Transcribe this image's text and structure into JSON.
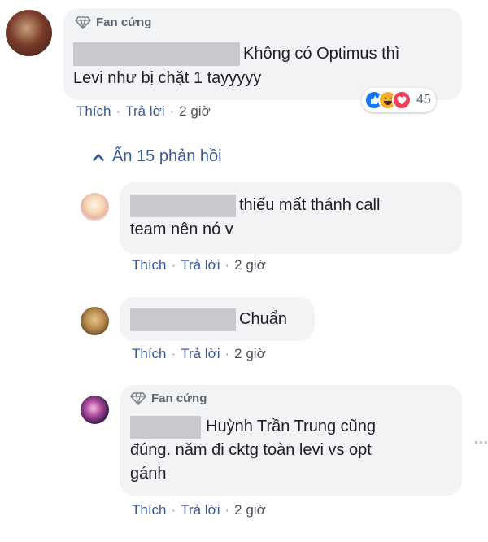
{
  "comment": {
    "badge": "Fan cứng",
    "text_line1": "Không có Optimus thì",
    "text_line2": "Levi như bị chặt 1 tayyyyy",
    "reactions": {
      "count": "45",
      "types": [
        "like-icon",
        "haha-icon",
        "love-icon"
      ]
    },
    "actions": {
      "like": "Thích",
      "reply": "Trả lời",
      "time": "2 giờ",
      "separator": "·"
    }
  },
  "replies_toggle": {
    "label": "Ẩn 15 phản hồi"
  },
  "replies": [
    {
      "text_line1": "thiếu mất thánh call",
      "text_line2": "team nên nó v",
      "actions": {
        "like": "Thích",
        "reply": "Trả lời",
        "time": "2 giờ",
        "separator": "·"
      }
    },
    {
      "text_line1": "Chuẩn",
      "actions": {
        "like": "Thích",
        "reply": "Trả lời",
        "time": "2 giờ",
        "separator": "·"
      }
    },
    {
      "badge": "Fan cứng",
      "text_line1": "Huỳnh Trần Trung cũng",
      "text_line2": "đúng. năm đi cktg toàn levi vs opt",
      "text_line3": "gánh",
      "actions": {
        "like": "Thích",
        "reply": "Trả lời",
        "time": "2 giờ",
        "separator": "·"
      }
    }
  ],
  "colors": {
    "link": "#385898",
    "bubble": "#f2f3f5",
    "like": "#1877f2",
    "haha": "#f7b125",
    "love": "#f33e58"
  }
}
